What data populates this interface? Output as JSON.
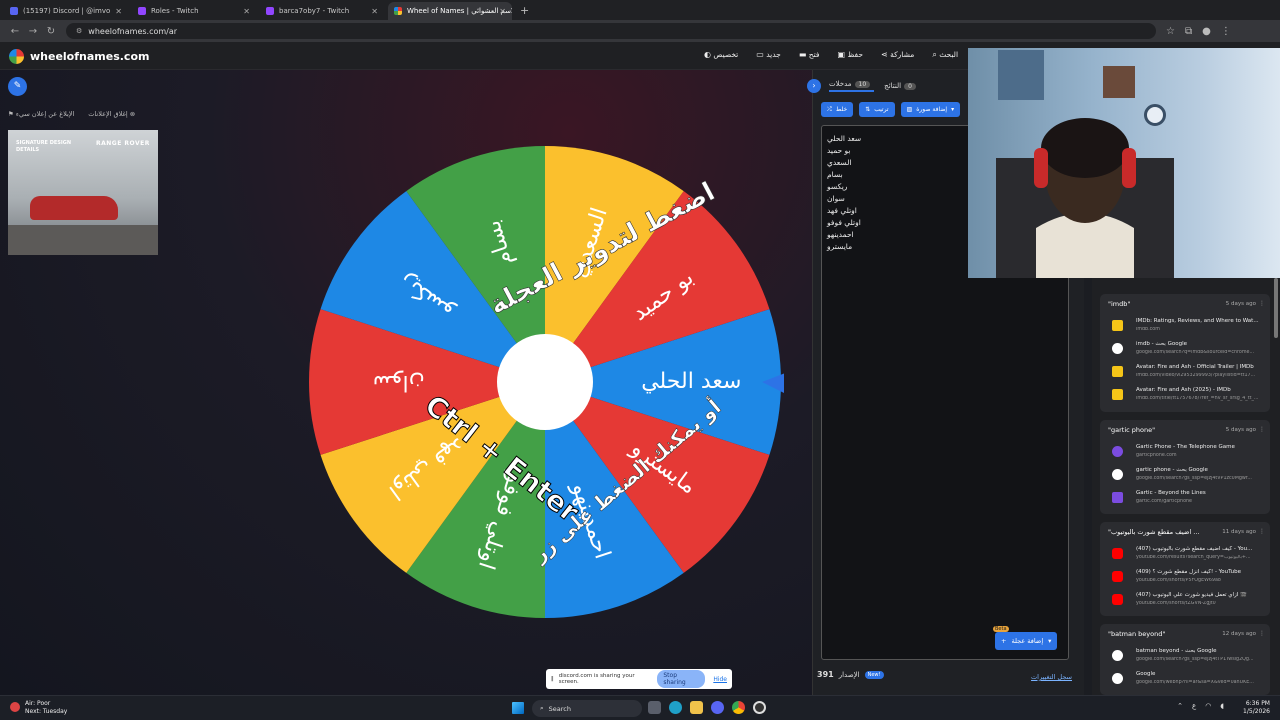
{
  "browser": {
    "tabs": [
      {
        "title": "(15197) Discord | @imvo",
        "color": "#5865f2"
      },
      {
        "title": "Roles - Twitch",
        "color": "#9146ff"
      },
      {
        "title": "barca7oby7 - Twitch",
        "color": "#9146ff"
      },
      {
        "title": "Wheel of Names | عجلة الاسم العشوائي",
        "color": "#e53935"
      }
    ],
    "new_tab": "+",
    "url": "wheelofnames.com/ar"
  },
  "app": {
    "logo": "wheelofnames.com",
    "menu": [
      {
        "label": "تخصيص",
        "icon": "palette-icon"
      },
      {
        "label": "جديد",
        "icon": "new-file-icon"
      },
      {
        "label": "فتح",
        "icon": "folder-icon"
      },
      {
        "label": "حفظ",
        "icon": "save-icon"
      },
      {
        "label": "مشاركة",
        "icon": "share-icon"
      },
      {
        "label": "البحث",
        "icon": "search-icon"
      }
    ],
    "ad_links": {
      "close_ads": "إغلاق الإعلانات",
      "report_ad": "الإبلاغ عن إعلان سيء"
    },
    "ad": {
      "tagline": "SIGNATURE DESIGN DETAILS",
      "brand": "RANGE ROVER"
    }
  },
  "wheel": {
    "segments": [
      {
        "label": "سعد الحلي",
        "color": "#1e88e5"
      },
      {
        "label": "مايسترو",
        "color": "#e53935"
      },
      {
        "label": "احمدينهو",
        "color": "#1e88e5"
      },
      {
        "label": "اوتلي فوفو",
        "color": "#43a047"
      },
      {
        "label": "اوتلي فهد",
        "color": "#fbc02d"
      },
      {
        "label": "سوان",
        "color": "#e53935"
      },
      {
        "label": "ريكسو",
        "color": "#1e88e5"
      },
      {
        "label": "بسام",
        "color": "#43a047"
      },
      {
        "label": "السعدي",
        "color": "#fbc02d"
      },
      {
        "label": "بو حميد",
        "color": "#e53935"
      }
    ],
    "overlay_top": "اضغط لتدوير العجلة",
    "overlay_bottom_1": "Ctrl + Enter",
    "overlay_bottom_2": "أو يمكنك الضغط على زر"
  },
  "panel": {
    "tab_entries": "مدخلات",
    "entries_count": "10",
    "tab_results": "النتائج",
    "results_count": "0",
    "shuffle": "خلط",
    "sort": "ترتيب",
    "add_image": "إضافة صورة",
    "entries": [
      "سعد الحلي",
      "بو حميد",
      "السعدي",
      "بسام",
      "ريكسو",
      "سوان",
      "اوتلي فهد",
      "اوتلي فوفو",
      "احمدينهو",
      "مايسترو"
    ],
    "add_wheel": "إضافة عجلة",
    "beta": "Beta",
    "version_label": "الإصدار",
    "version": "391",
    "new_badge": "New!",
    "changelog": "سجل التغييرات"
  },
  "history": [
    {
      "query": "\"imdb\"",
      "date": "5 days ago",
      "items": [
        {
          "name": "IMDb: Ratings, Reviews, and Where to Wat...",
          "url": "imdb.com",
          "icon": "#f5c518"
        },
        {
          "name": "imdb - بحث Google",
          "url": "google.com/search?q=imdb&sourceid=chrome...",
          "icon": "#ffffff"
        },
        {
          "name": "Avatar: Fire and Ash - Official Trailer | IMDb",
          "url": "imdb.com/video/vi2953299993/?playlistId=tt17...",
          "icon": "#f5c518"
        },
        {
          "name": "Avatar: Fire and Ash (2025) - IMDb",
          "url": "imdb.com/title/tt1757678/?ref_=nv_sr_srsg_4_tt_...",
          "icon": "#f5c518"
        }
      ]
    },
    {
      "query": "\"gartic phone\"",
      "date": "5 days ago",
      "items": [
        {
          "name": "Gartic Phone - The Telephone Game",
          "url": "garticphone.com",
          "icon": "#7b4ce0"
        },
        {
          "name": "gartic phone - بحث Google",
          "url": "google.com/search?gs_ssp=eJzj4tVP1zc0Mgwr...",
          "icon": "#ffffff"
        },
        {
          "name": "Gartic - Beyond the Lines",
          "url": "gartic.com/garticphone",
          "icon": "#7b4ce0"
        }
      ]
    },
    {
      "query": "\"اضيف مقطع شورت باليوتيوب ...",
      "date": "11 days ago",
      "items": [
        {
          "name": "(407) كيف اضيف مقطع شورت باليوتيوب - You...",
          "url": "youtube.com/results?search_query=باليوتيوب+...",
          "icon": "#ff0000"
        },
        {
          "name": "(409) كيف انزل مقطع شورت ؟! - YouTube",
          "url": "youtube.com/shorts/P5FOgEW69a8",
          "icon": "#ff0000"
        },
        {
          "name": "(407) ازاي تعمل فيديو شورت علي اليوتيوب 🎬",
          "url": "youtube.com/shorts/tZGVN-ZgJt0",
          "icon": "#ff0000"
        }
      ]
    },
    {
      "query": "\"batman beyond\"",
      "date": "12 days ago",
      "items": [
        {
          "name": "batman beyond - بحث Google",
          "url": "google.com/search?gs_ssp=eJzj4tTP1Twsig2Qg...",
          "icon": "#ffffff"
        },
        {
          "name": "Google",
          "url": "google.com/webhp?hl=ar&sa=X&ved=0ahUKE...",
          "icon": "#ffffff"
        }
      ]
    }
  ],
  "share_bar": {
    "text": "discord.com is sharing your screen.",
    "stop": "Stop sharing",
    "hide": "Hide"
  },
  "taskbar": {
    "weather_title": "Air: Poor",
    "weather_sub": "Next: Tuesday",
    "search": "Search",
    "time": "6:36 PM",
    "date": "1/5/2026",
    "lang": "ع"
  }
}
